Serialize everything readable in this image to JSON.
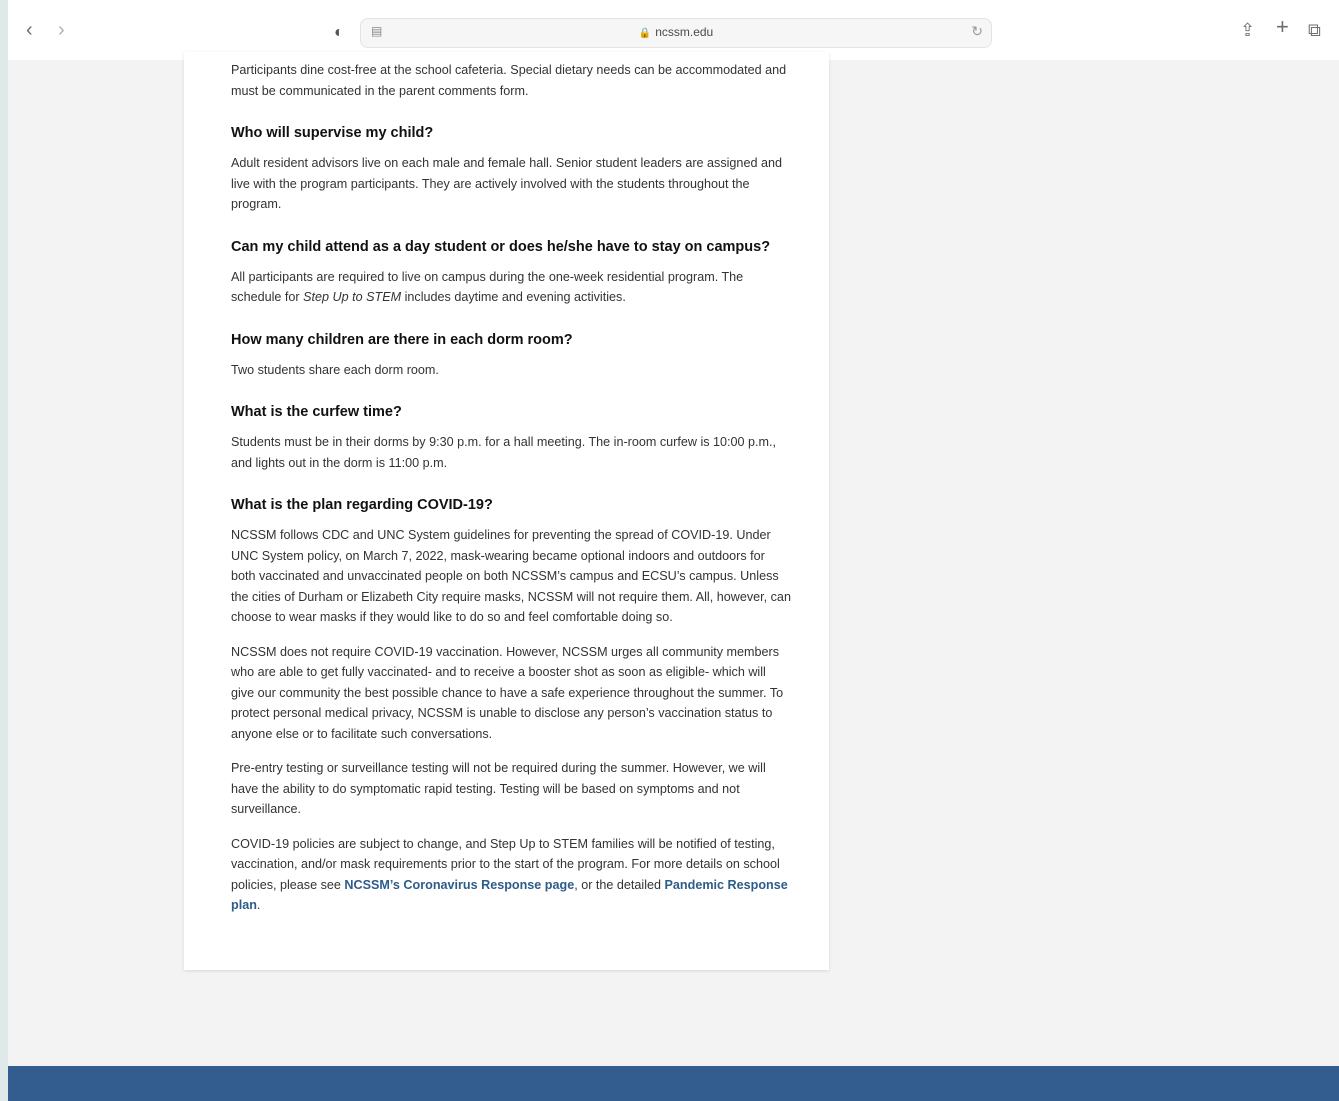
{
  "browser": {
    "url": "ncssm.edu"
  },
  "article": {
    "p_dining": "Participants dine cost-free at the school cafeteria. Special dietary needs can be accommodated and must be communicated in the parent comments form.",
    "h_supervise": "Who will supervise my child?",
    "p_supervise": "Adult resident advisors live on each male and female hall. Senior student leaders are assigned and live with the program participants. They are actively involved with the students throughout the program.",
    "h_daystudent": "Can my child attend as a day student or does he/she have to stay on campus?",
    "p_daystudent_a": "All participants are required to live on campus during the one-week residential program. The schedule for ",
    "p_daystudent_em": "Step Up to STEM",
    "p_daystudent_b": " includes daytime and evening activities.",
    "h_dorm": "How many children are there in each dorm room?",
    "p_dorm": "Two students share each dorm room.",
    "h_curfew": "What is the curfew time?",
    "p_curfew": "Students must be in their dorms by 9:30 p.m. for a hall meeting. The in-room curfew is 10:00 p.m., and lights out in the dorm is 11:00 p.m.",
    "h_covid": "What is the plan regarding COVID-19?",
    "p_covid1": "NCSSM follows CDC and UNC System guidelines for preventing the spread of COVID-19. Under UNC System policy, on March 7, 2022, mask-wearing became optional indoors and outdoors for both vaccinated and unvaccinated people on both NCSSM’s campus and ECSU’s campus. Unless the cities of Durham or Elizabeth City require masks, NCSSM will not require them. All, however, can choose to wear masks if they would like to do so and feel comfortable doing so.",
    "p_covid2": "NCSSM does not require COVID-19 vaccination. However, NCSSM urges all community members who are able to get fully vaccinated- and to receive a booster shot as soon as eligible- which will give our community the best possible chance to have a safe experience throughout the summer. To protect personal medical privacy, NCSSM is unable to disclose any person’s vaccination status to anyone else or to facilitate such conversations.",
    "p_covid3": "Pre-entry testing or surveillance testing will not be required during the summer. However, we will have the ability to do symptomatic rapid testing. Testing will be based on symptoms and not surveillance.",
    "p_covid4_a": "COVID-19 policies are subject to change, and Step Up to STEM families will be notified of testing, vaccination, and/or mask requirements prior to the start of the program. For more details on school policies, please see ",
    "link_coronavirus": "NCSSM’s Coronavirus Response page",
    "p_covid4_b": ", or the detailed ",
    "link_pandemic": "Pandemic Response plan",
    "p_covid4_c": "."
  },
  "icons": {
    "back": "‹",
    "forward": "›",
    "shield": "◐",
    "page": "▤",
    "lock": "🔒",
    "reload": "↻",
    "share": "⇪",
    "plus": "+",
    "tabs": "⧉"
  },
  "colors": {
    "link": "#2e5c8a",
    "footer": "#335d8e"
  }
}
